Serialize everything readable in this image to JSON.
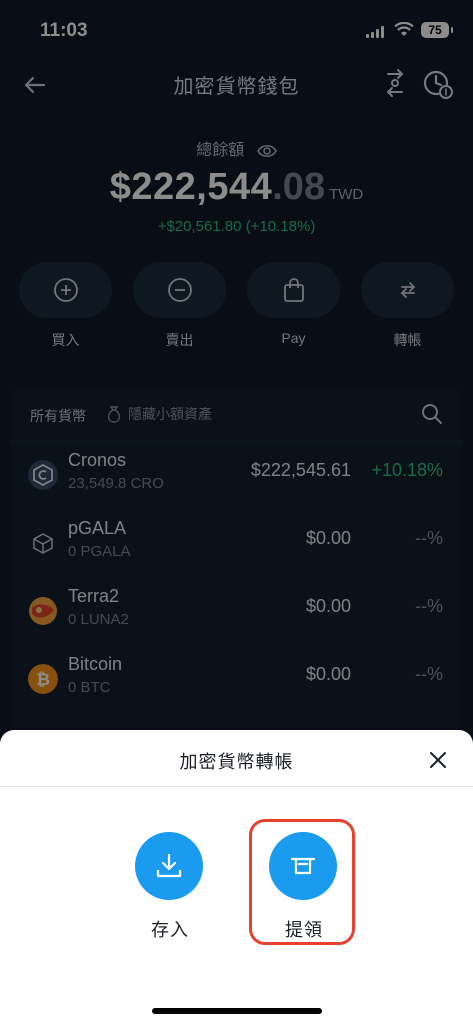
{
  "status_bar": {
    "time": "11:03",
    "battery": "75"
  },
  "header": {
    "title": "加密貨幣錢包"
  },
  "balance": {
    "label": "總餘額",
    "main": "$222,544",
    "decimals": ".08",
    "currency": "TWD",
    "change": "+$20,561.80 (+10.18%)"
  },
  "actions": [
    {
      "label": "買入",
      "icon": "plus-circle-icon"
    },
    {
      "label": "賣出",
      "icon": "minus-circle-icon"
    },
    {
      "label": "Pay",
      "icon": "shopping-bag-icon"
    },
    {
      "label": "轉帳",
      "icon": "transfer-arrows-icon"
    }
  ],
  "assets": {
    "all_label": "所有貨幣",
    "hide_small_label": "隱藏小額資產",
    "rows": [
      {
        "name": "Cronos",
        "amount": "23,549.8 CRO",
        "value": "$222,545.61",
        "pct": "+10.18%",
        "coin_color": "#3a4a63"
      },
      {
        "name": "pGALA",
        "amount": "0 PGALA",
        "value": "$0.00",
        "pct": "--%",
        "coin_color": "#222d3c"
      },
      {
        "name": "Terra2",
        "amount": "0 LUNA2",
        "value": "$0.00",
        "pct": "--%",
        "coin_color": "#f2a33a"
      },
      {
        "name": "Bitcoin",
        "amount": "0 BTC",
        "value": "$0.00",
        "pct": "--%",
        "coin_color": "#f7931a"
      }
    ]
  },
  "sheet": {
    "title": "加密貨幣轉帳",
    "deposit_label": "存入",
    "withdraw_label": "提領",
    "accent": "#1a9bf0",
    "highlight_color": "#e7402e"
  }
}
